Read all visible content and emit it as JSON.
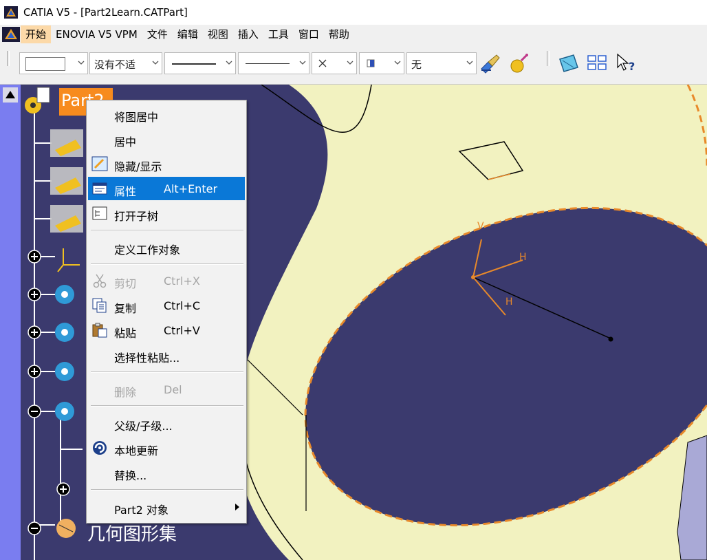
{
  "window": {
    "title": "CATIA V5 - [Part2Learn.CATPart]"
  },
  "menubar": {
    "items": [
      "开始",
      "ENOVIA V5 VPM",
      "文件",
      "编辑",
      "视图",
      "插入",
      "工具",
      "窗口",
      "帮助"
    ]
  },
  "toolbar": {
    "transparency_value": "没有不适",
    "layer_value": "无"
  },
  "tree": {
    "root_label": "Part2",
    "geo_set_label": "几何图形集"
  },
  "context_menu": {
    "items": [
      {
        "label": "将图居中",
        "shortcut": "",
        "disabled": false
      },
      {
        "label": "居中",
        "shortcut": "",
        "disabled": false
      },
      {
        "label": "隐藏/显示",
        "shortcut": "",
        "disabled": false
      },
      {
        "label": "属性",
        "shortcut": "Alt+Enter",
        "disabled": false
      },
      {
        "label": "打开子树",
        "shortcut": "",
        "disabled": false
      },
      {
        "label": "定义工作对象",
        "shortcut": "",
        "disabled": false
      },
      {
        "label": "剪切",
        "shortcut": "Ctrl+X",
        "disabled": true
      },
      {
        "label": "复制",
        "shortcut": "Ctrl+C",
        "disabled": false
      },
      {
        "label": "粘贴",
        "shortcut": "Ctrl+V",
        "disabled": false
      },
      {
        "label": "选择性粘贴...",
        "shortcut": "",
        "disabled": false
      },
      {
        "label": "删除",
        "shortcut": "Del",
        "disabled": true
      },
      {
        "label": "父级/子级...",
        "shortcut": "",
        "disabled": false
      },
      {
        "label": "本地更新",
        "shortcut": "",
        "disabled": false
      },
      {
        "label": "替换...",
        "shortcut": "",
        "disabled": false
      },
      {
        "label": "Part2 对象",
        "shortcut": "",
        "disabled": false
      }
    ]
  },
  "axis_labels": {
    "v": "V",
    "h": "H"
  },
  "colors": {
    "highlight": "#0a78d7",
    "tree_selected": "#f78b1e",
    "background": "#3b3a6e",
    "part_surface": "#f2f2c0"
  }
}
